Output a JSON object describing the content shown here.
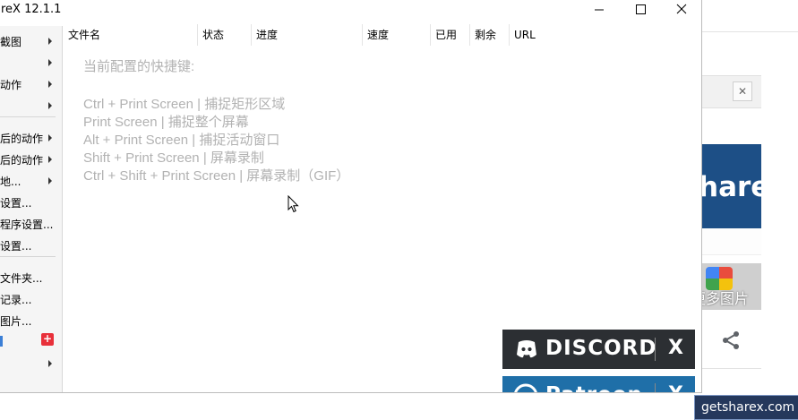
{
  "window": {
    "title": "reX 12.1.1",
    "minimize_glyph": "—",
    "maximize_glyph": "☐",
    "close_glyph": "✕"
  },
  "sidebar": {
    "items": [
      {
        "label": "截图",
        "arrow": true
      },
      {
        "label": "",
        "arrow": true
      },
      {
        "label": "动作",
        "arrow": true
      },
      {
        "label": "",
        "arrow": true
      },
      {
        "label": "后的动作",
        "arrow": true
      },
      {
        "label": "后的动作",
        "arrow": true
      },
      {
        "label": "地...",
        "arrow": true
      },
      {
        "label": "设置...",
        "arrow": false
      },
      {
        "label": "程序设置...",
        "arrow": false
      },
      {
        "label": "设置...",
        "arrow": false
      },
      {
        "label": "文件夹...",
        "arrow": false
      },
      {
        "label": "记录...",
        "arrow": false
      },
      {
        "label": "图片...",
        "arrow": false
      },
      {
        "label": "",
        "arrow": false,
        "badge": "+"
      },
      {
        "label": "",
        "arrow": true
      }
    ]
  },
  "list": {
    "columns": [
      "文件名",
      "状态",
      "进度",
      "速度",
      "已用",
      "剩余",
      "URL"
    ]
  },
  "hints": {
    "title": "当前配置的快捷键:",
    "lines": [
      "Ctrl + Print Screen  |  捕捉矩形区域",
      "Print Screen  |  捕捉整个屏幕",
      "Alt + Print Screen  |  捕捉活动窗口",
      "Shift + Print Screen  |  屏幕录制",
      "Ctrl + Shift + Print Screen  |  屏幕录制（GIF）"
    ]
  },
  "promos": {
    "discord_label": "DISCORD",
    "patreon_label": "Patreon",
    "close_label": "X"
  },
  "background": {
    "close_glyph": "✕",
    "banner_text": "hareX",
    "more_images_label": "更多图片",
    "site_badge": "getsharex.com"
  },
  "colors": {
    "hint_text": "#b2b2b2",
    "discord_bg": "#2c2f33",
    "patreon_bg": "#1f6fa8",
    "banner_bg": "#1d4f86",
    "badge_bg": "#25385c",
    "menu_badge_red": "#e8303a"
  }
}
